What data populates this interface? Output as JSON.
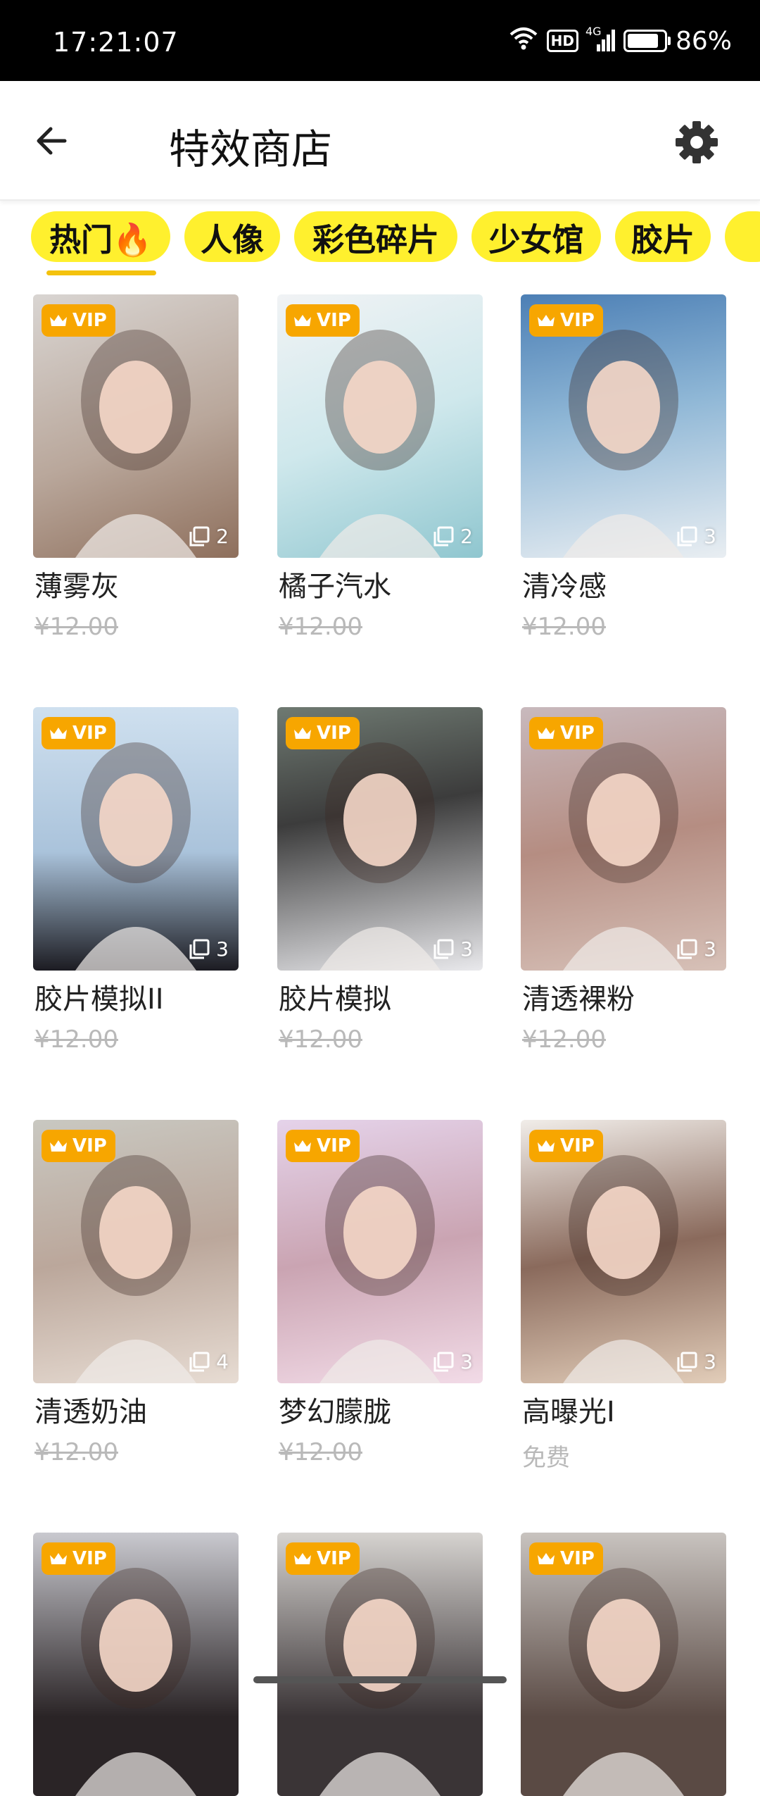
{
  "status_bar": {
    "time": "17:21:07",
    "network": "4G",
    "hd": "HD",
    "battery": "86%",
    "battery_level": 0.86
  },
  "header": {
    "title": "特效商店"
  },
  "categories": [
    {
      "label": "热门🔥",
      "active": true
    },
    {
      "label": "人像"
    },
    {
      "label": "彩色碎片"
    },
    {
      "label": "少女馆"
    },
    {
      "label": "胶片"
    }
  ],
  "products": [
    {
      "name": "薄雾灰",
      "price": "¥12.00",
      "strike": true,
      "badge": "VIP",
      "count": "2",
      "image": "woman-portrait-long-hair"
    },
    {
      "name": "橘子汽水",
      "price": "¥12.00",
      "strike": true,
      "badge": "VIP",
      "count": "2",
      "image": "woman-portrait-short-hair"
    },
    {
      "name": "清冷感",
      "price": "¥12.00",
      "strike": true,
      "badge": "VIP",
      "count": "3",
      "image": "woman-portrait-seaside"
    },
    {
      "name": "胶片模拟II",
      "price": "¥12.00",
      "strike": true,
      "badge": "VIP",
      "count": "3",
      "image": "woman-portrait-sunglasses"
    },
    {
      "name": "胶片模拟",
      "price": "¥12.00",
      "strike": true,
      "badge": "VIP",
      "count": "3",
      "image": "woman-portrait-bob"
    },
    {
      "name": "清透裸粉",
      "price": "¥12.00",
      "strike": true,
      "badge": "VIP",
      "count": "3",
      "image": "woman-portrait-pink"
    },
    {
      "name": "清透奶油",
      "price": "¥12.00",
      "strike": true,
      "badge": "VIP",
      "count": "4",
      "image": "woman-portrait-cream"
    },
    {
      "name": "梦幻朦胧",
      "price": "¥12.00",
      "strike": true,
      "badge": "VIP",
      "count": "3",
      "image": "woman-portrait-dreamy"
    },
    {
      "name": "高曝光I",
      "price": "免费",
      "strike": false,
      "badge": "VIP",
      "count": "3",
      "image": "woman-portrait-smile"
    },
    {
      "name": "",
      "price": "",
      "strike": false,
      "badge": "VIP",
      "count": "",
      "image": "woman-portrait-dark-hair"
    },
    {
      "name": "",
      "price": "",
      "strike": false,
      "badge": "VIP",
      "count": "",
      "image": "woman-portrait-straight-hair"
    },
    {
      "name": "",
      "price": "",
      "strike": false,
      "badge": "VIP",
      "count": "",
      "image": "woman-portrait-wavy-hair"
    }
  ],
  "colors": {
    "accent_yellow": "#FFF02E",
    "vip_orange": "#F7A600",
    "price_gray": "#B9B9B9"
  }
}
